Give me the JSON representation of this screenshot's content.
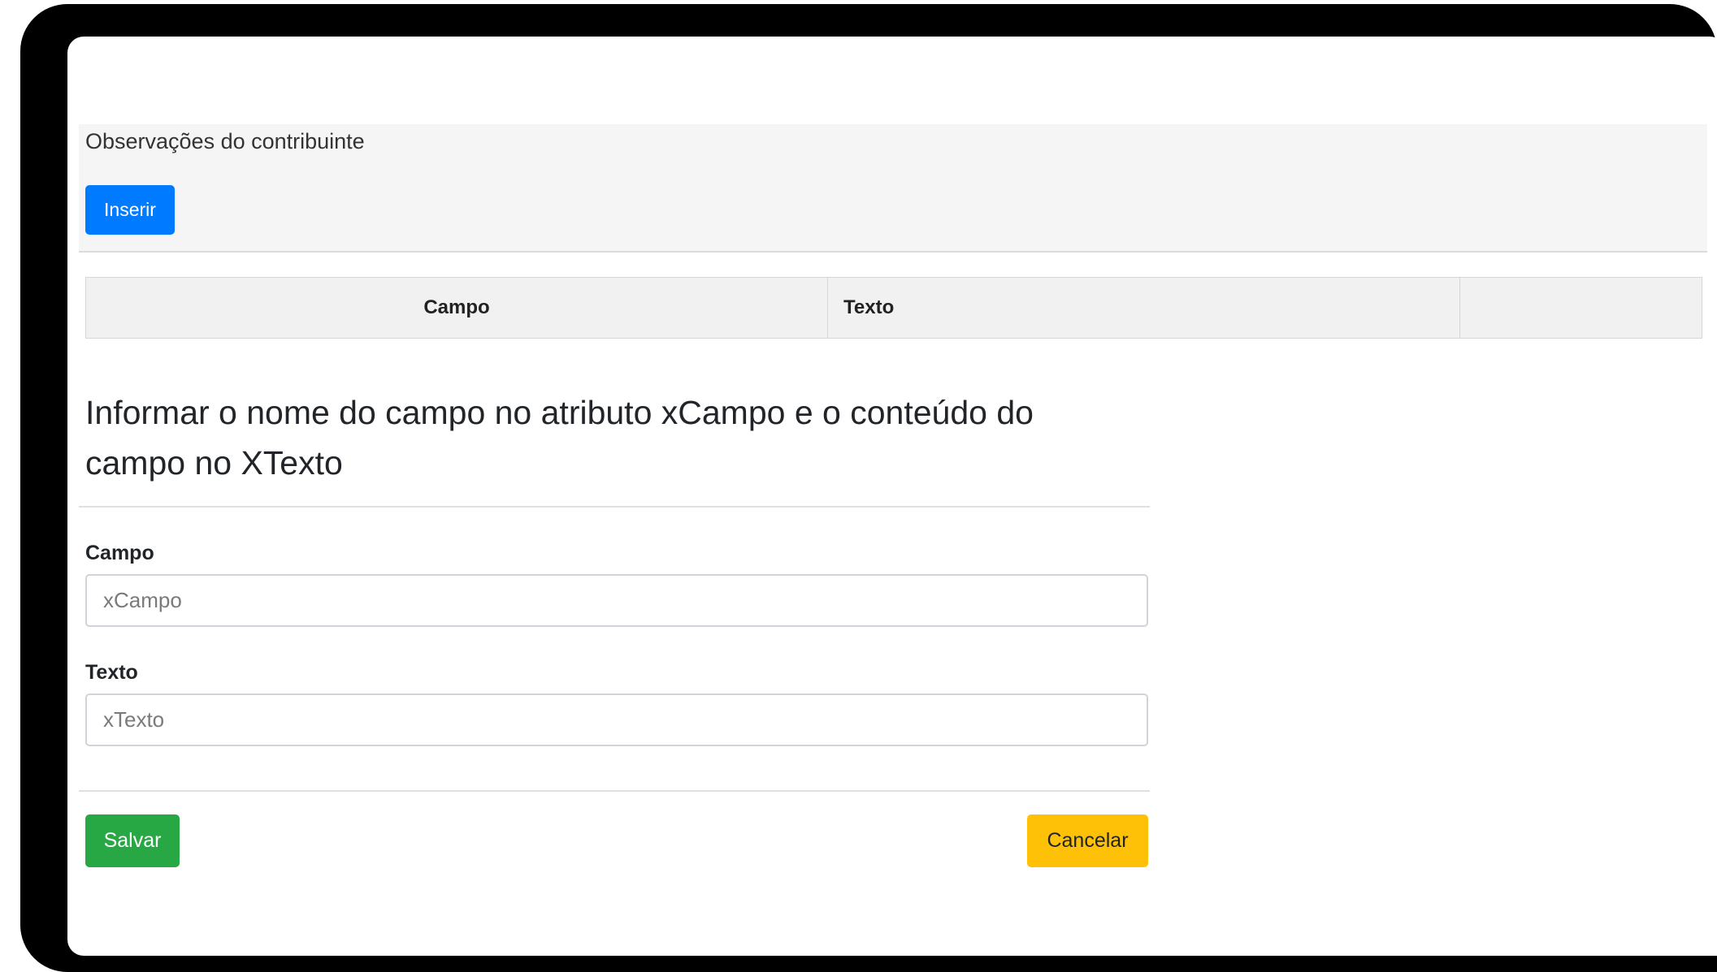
{
  "panel": {
    "title": "Observações do contribuinte",
    "insert_label": "Inserir"
  },
  "grid": {
    "columns": [
      "Campo",
      "Texto",
      ""
    ]
  },
  "form": {
    "title": "Informar o nome do campo no atributo xCampo e o conteúdo do campo no XTexto",
    "campo_label": "Campo",
    "campo_placeholder": "xCampo",
    "texto_label": "Texto",
    "texto_placeholder": "xTexto",
    "save_label": "Salvar",
    "cancel_label": "Cancelar"
  },
  "colors": {
    "primary": "#007bff",
    "success": "#28a745",
    "warning": "#ffc107"
  }
}
